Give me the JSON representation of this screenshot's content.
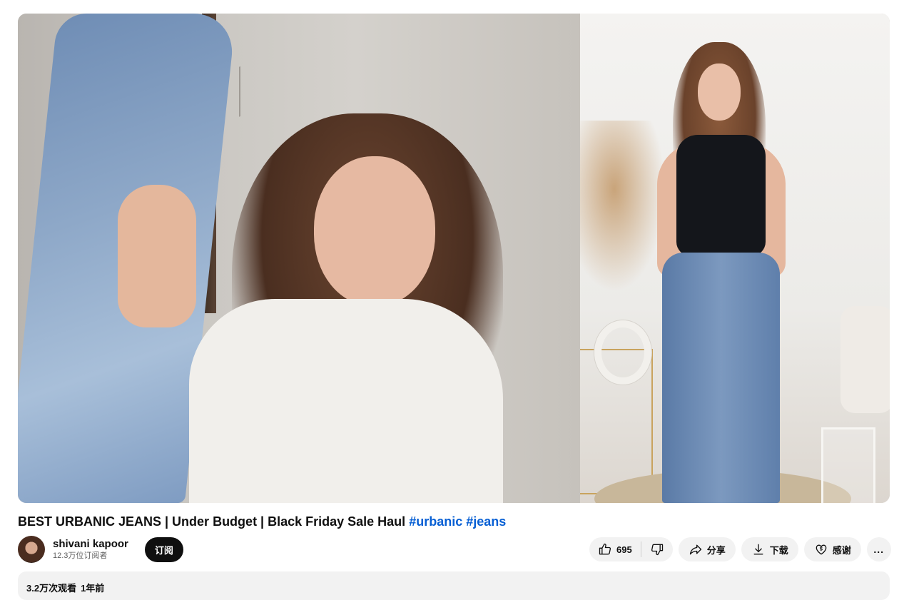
{
  "video": {
    "title_main": "BEST URBANIC JEANS | Under Budget | Black Friday Sale Haul",
    "hashtags": [
      "#urbanic",
      "#jeans"
    ]
  },
  "channel": {
    "name": "shivani kapoor",
    "subscribers": "12.3万位订阅者",
    "subscribe_label": "订阅"
  },
  "actions": {
    "like_count": "695",
    "share_label": "分享",
    "download_label": "下载",
    "thanks_label": "感谢",
    "more_label": "..."
  },
  "description": {
    "views": "3.2万次观看",
    "age": "1年前"
  },
  "colors": {
    "accent_link": "#065fd4",
    "subscribe_bg": "#0f0f0f",
    "pill_bg": "#f2f2f2"
  }
}
